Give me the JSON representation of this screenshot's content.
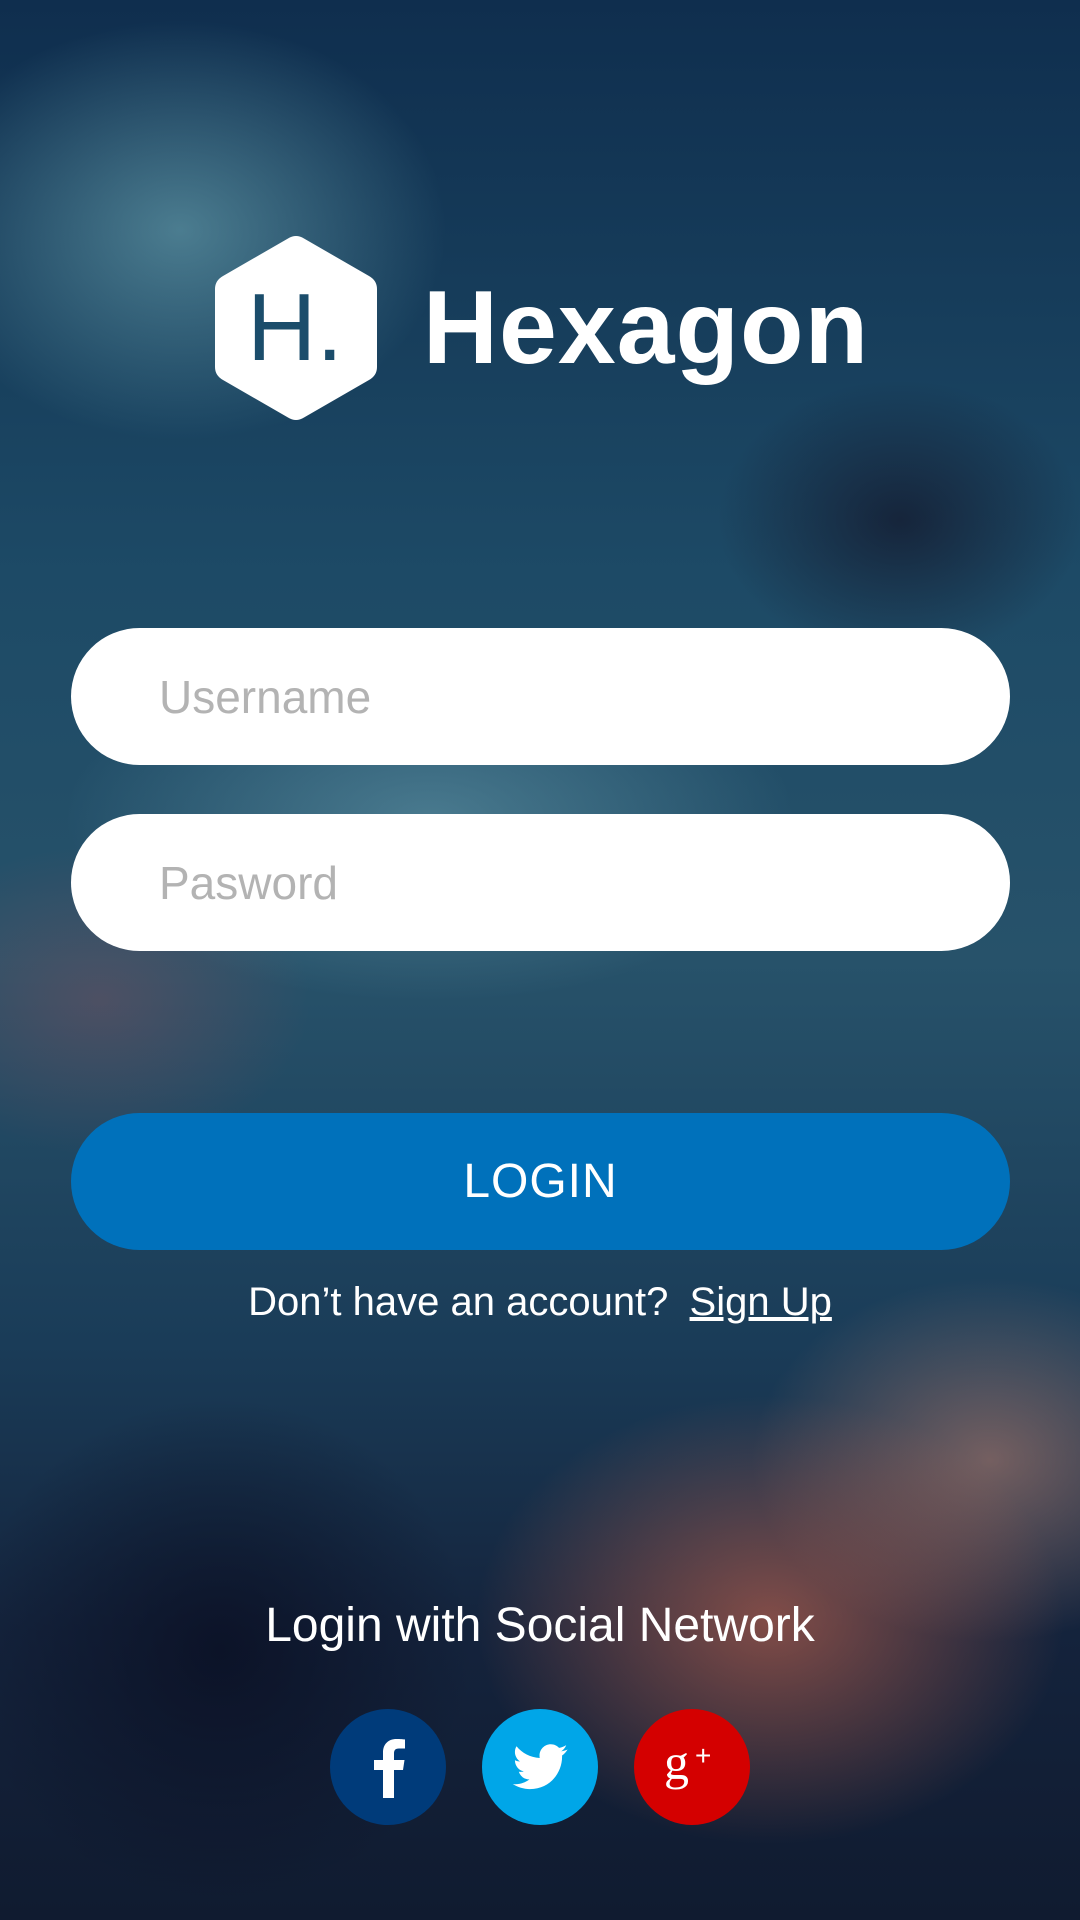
{
  "brand": {
    "logo_letter": "H.",
    "name": "Hexagon"
  },
  "form": {
    "username_placeholder": "Username",
    "username_value": "",
    "password_placeholder": "Pasword",
    "password_value": "",
    "login_label": "LOGIN"
  },
  "signup": {
    "prompt": "Don’t have an account?",
    "link_label": "Sign Up"
  },
  "social": {
    "title": "Login with Social Network",
    "buttons": [
      {
        "icon": "facebook-icon",
        "color": "#003b7a"
      },
      {
        "icon": "twitter-icon",
        "color": "#00a6e8"
      },
      {
        "icon": "google-plus-icon",
        "color": "#d40000"
      }
    ]
  },
  "colors": {
    "accent": "#0071bb",
    "facebook": "#003b7a",
    "twitter": "#00a6e8",
    "google_plus": "#d40000"
  }
}
